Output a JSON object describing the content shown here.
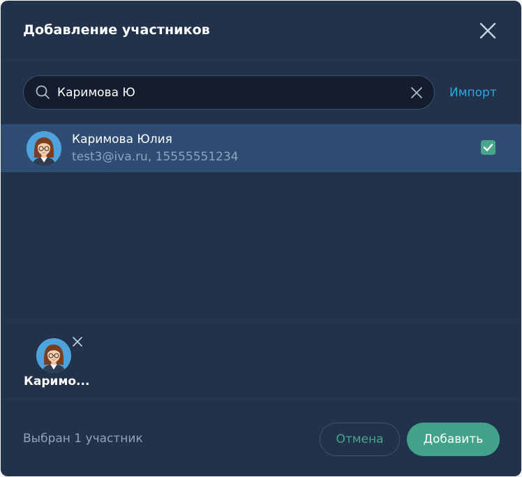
{
  "dialog": {
    "title": "Добавление участников",
    "close_icon": "close-icon"
  },
  "search": {
    "value": "Каримова Ю",
    "icon": "search-icon",
    "clear_icon": "clear-icon",
    "import_label": "Импорт"
  },
  "results": [
    {
      "name": "Каримова Юлия",
      "details": "test3@iva.ru, 15555551234",
      "checked": true,
      "avatar_icon": "female-avatar-icon"
    }
  ],
  "selected": [
    {
      "short_name": "Каримо...",
      "avatar_icon": "female-avatar-icon",
      "remove_icon": "remove-icon"
    }
  ],
  "footer": {
    "status": "Выбран 1 участник",
    "cancel_label": "Отмена",
    "add_label": "Добавить"
  },
  "colors": {
    "background": "#21324a",
    "selected_row": "#2f4d72",
    "accent_green": "#43a38a",
    "link_blue": "#2ea7e6",
    "muted_text": "#8ea4bf"
  }
}
